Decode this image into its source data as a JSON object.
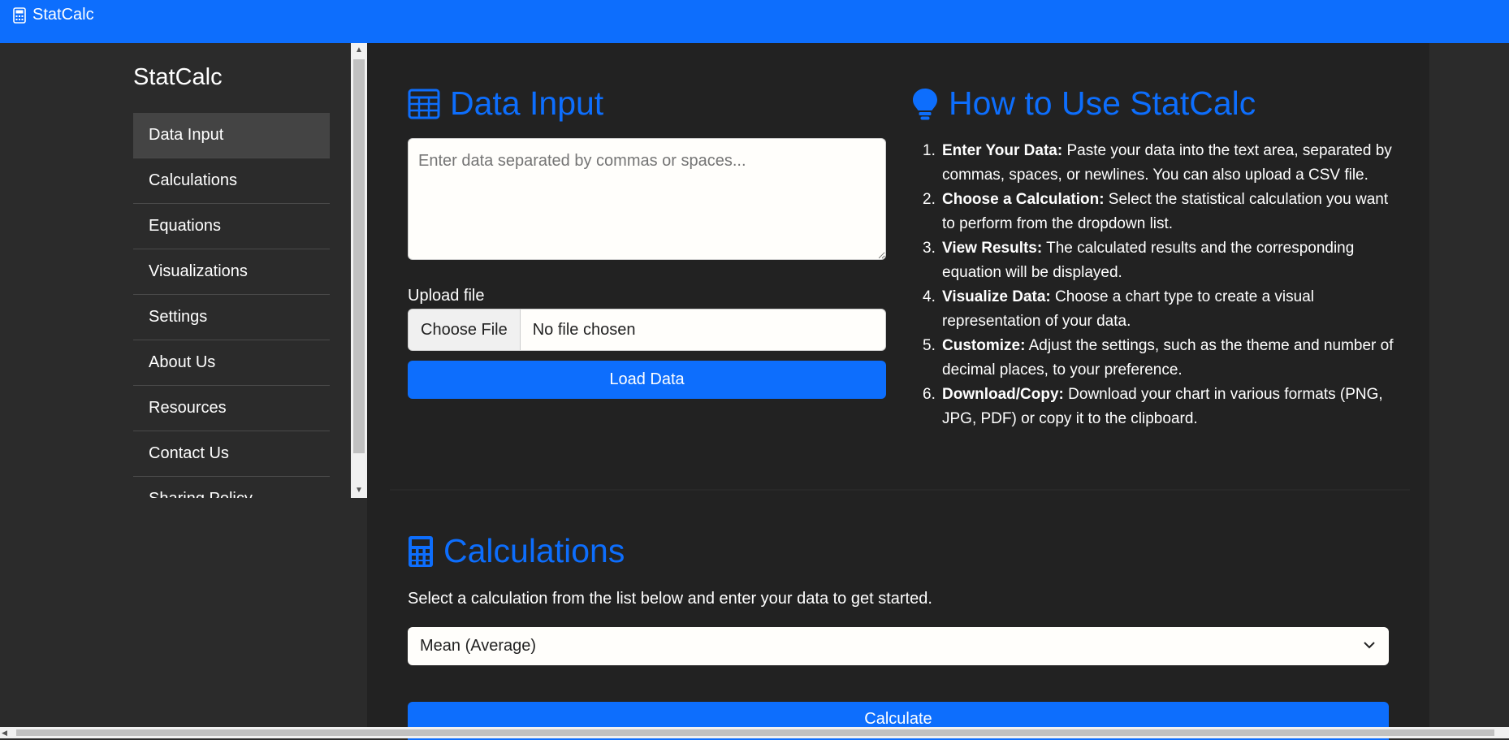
{
  "app": {
    "title": "StatCalc"
  },
  "sidebar": {
    "title": "StatCalc",
    "items": [
      {
        "label": "Data Input"
      },
      {
        "label": "Calculations"
      },
      {
        "label": "Equations"
      },
      {
        "label": "Visualizations"
      },
      {
        "label": "Settings"
      },
      {
        "label": "About Us"
      },
      {
        "label": "Resources"
      },
      {
        "label": "Contact Us"
      },
      {
        "label": "Sharing Policy"
      }
    ]
  },
  "data_input": {
    "heading": "Data Input",
    "textarea_placeholder": "Enter data separated by commas or spaces...",
    "upload_label": "Upload file",
    "file_button": "Choose File",
    "file_status": "No file chosen",
    "load_button": "Load Data"
  },
  "how_to": {
    "heading": "How to Use StatCalc",
    "steps": [
      {
        "num": "1.",
        "title": "Enter Your Data:",
        "text": " Paste your data into the text area, separated by commas, spaces, or newlines. You can also upload a CSV file."
      },
      {
        "num": "2.",
        "title": "Choose a Calculation:",
        "text": " Select the statistical calculation you want to perform from the dropdown list."
      },
      {
        "num": "3.",
        "title": "View Results:",
        "text": " The calculated results and the corresponding equation will be displayed."
      },
      {
        "num": "4.",
        "title": "Visualize Data:",
        "text": " Choose a chart type to create a visual representation of your data."
      },
      {
        "num": "5.",
        "title": "Customize:",
        "text": " Adjust the settings, such as the theme and number of decimal places, to your preference."
      },
      {
        "num": "6.",
        "title": "Download/Copy:",
        "text": " Download your chart in various formats (PNG, JPG, PDF) or copy it to the clipboard."
      }
    ]
  },
  "calculations": {
    "heading": "Calculations",
    "description": "Select a calculation from the list below and enter your data to get started.",
    "selected": "Mean (Average)",
    "calculate_button": "Calculate"
  },
  "colors": {
    "accent": "#0d6efd",
    "main_bg": "#222222",
    "side_bg": "#2b2b2b"
  },
  "icons": {
    "brand": "calculator-icon",
    "data_input": "table-icon",
    "how_to": "lightbulb-icon",
    "calculations": "calculator-icon"
  }
}
